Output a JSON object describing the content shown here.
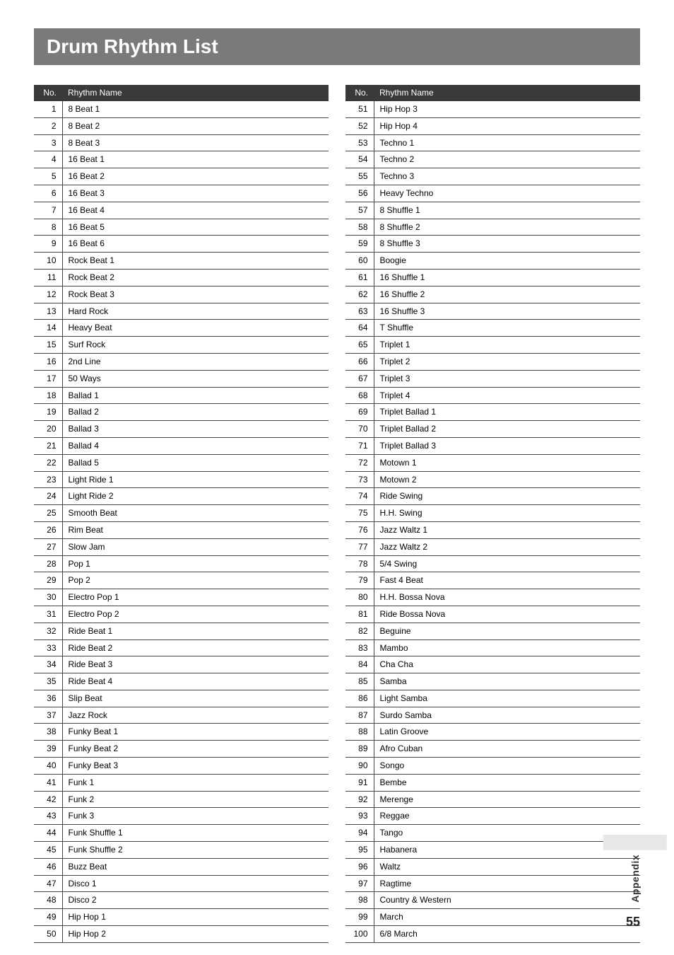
{
  "title": "Drum Rhythm List",
  "headers": {
    "no": "No.",
    "name": "Rhythm Name"
  },
  "side_label": "Appendix",
  "page_number": "55",
  "left_rows": [
    {
      "no": "1",
      "name": "8 Beat 1"
    },
    {
      "no": "2",
      "name": "8 Beat 2"
    },
    {
      "no": "3",
      "name": "8 Beat 3"
    },
    {
      "no": "4",
      "name": "16 Beat 1"
    },
    {
      "no": "5",
      "name": "16 Beat 2"
    },
    {
      "no": "6",
      "name": "16 Beat 3"
    },
    {
      "no": "7",
      "name": "16 Beat 4"
    },
    {
      "no": "8",
      "name": "16 Beat 5"
    },
    {
      "no": "9",
      "name": "16 Beat 6"
    },
    {
      "no": "10",
      "name": "Rock Beat 1"
    },
    {
      "no": "11",
      "name": "Rock Beat 2"
    },
    {
      "no": "12",
      "name": "Rock Beat 3"
    },
    {
      "no": "13",
      "name": "Hard Rock"
    },
    {
      "no": "14",
      "name": "Heavy Beat"
    },
    {
      "no": "15",
      "name": "Surf Rock"
    },
    {
      "no": "16",
      "name": "2nd Line"
    },
    {
      "no": "17",
      "name": "50 Ways"
    },
    {
      "no": "18",
      "name": "Ballad 1"
    },
    {
      "no": "19",
      "name": "Ballad 2"
    },
    {
      "no": "20",
      "name": "Ballad 3"
    },
    {
      "no": "21",
      "name": "Ballad 4"
    },
    {
      "no": "22",
      "name": "Ballad 5"
    },
    {
      "no": "23",
      "name": "Light Ride 1"
    },
    {
      "no": "24",
      "name": "Light Ride 2"
    },
    {
      "no": "25",
      "name": "Smooth Beat"
    },
    {
      "no": "26",
      "name": "Rim Beat"
    },
    {
      "no": "27",
      "name": "Slow Jam"
    },
    {
      "no": "28",
      "name": "Pop 1"
    },
    {
      "no": "29",
      "name": "Pop 2"
    },
    {
      "no": "30",
      "name": "Electro Pop 1"
    },
    {
      "no": "31",
      "name": "Electro Pop 2"
    },
    {
      "no": "32",
      "name": "Ride Beat 1"
    },
    {
      "no": "33",
      "name": "Ride Beat 2"
    },
    {
      "no": "34",
      "name": "Ride Beat 3"
    },
    {
      "no": "35",
      "name": "Ride Beat 4"
    },
    {
      "no": "36",
      "name": "Slip Beat"
    },
    {
      "no": "37",
      "name": "Jazz Rock"
    },
    {
      "no": "38",
      "name": "Funky Beat 1"
    },
    {
      "no": "39",
      "name": "Funky Beat 2"
    },
    {
      "no": "40",
      "name": "Funky Beat 3"
    },
    {
      "no": "41",
      "name": "Funk 1"
    },
    {
      "no": "42",
      "name": "Funk 2"
    },
    {
      "no": "43",
      "name": "Funk 3"
    },
    {
      "no": "44",
      "name": "Funk Shuffle 1"
    },
    {
      "no": "45",
      "name": "Funk Shuffle 2"
    },
    {
      "no": "46",
      "name": "Buzz Beat"
    },
    {
      "no": "47",
      "name": "Disco 1"
    },
    {
      "no": "48",
      "name": "Disco 2"
    },
    {
      "no": "49",
      "name": "Hip Hop 1"
    },
    {
      "no": "50",
      "name": "Hip Hop 2"
    }
  ],
  "right_rows": [
    {
      "no": "51",
      "name": "Hip Hop 3"
    },
    {
      "no": "52",
      "name": "Hip Hop 4"
    },
    {
      "no": "53",
      "name": "Techno 1"
    },
    {
      "no": "54",
      "name": "Techno 2"
    },
    {
      "no": "55",
      "name": "Techno 3"
    },
    {
      "no": "56",
      "name": "Heavy Techno"
    },
    {
      "no": "57",
      "name": "8 Shuffle 1"
    },
    {
      "no": "58",
      "name": "8 Shuffle 2"
    },
    {
      "no": "59",
      "name": "8 Shuffle 3"
    },
    {
      "no": "60",
      "name": "Boogie"
    },
    {
      "no": "61",
      "name": "16 Shuffle 1"
    },
    {
      "no": "62",
      "name": "16 Shuffle 2"
    },
    {
      "no": "63",
      "name": "16 Shuffle 3"
    },
    {
      "no": "64",
      "name": "T Shuffle"
    },
    {
      "no": "65",
      "name": "Triplet 1"
    },
    {
      "no": "66",
      "name": "Triplet 2"
    },
    {
      "no": "67",
      "name": "Triplet 3"
    },
    {
      "no": "68",
      "name": "Triplet 4"
    },
    {
      "no": "69",
      "name": "Triplet Ballad 1"
    },
    {
      "no": "70",
      "name": "Triplet Ballad 2"
    },
    {
      "no": "71",
      "name": "Triplet Ballad 3"
    },
    {
      "no": "72",
      "name": "Motown 1"
    },
    {
      "no": "73",
      "name": "Motown 2"
    },
    {
      "no": "74",
      "name": "Ride Swing"
    },
    {
      "no": "75",
      "name": "H.H. Swing"
    },
    {
      "no": "76",
      "name": "Jazz Waltz 1"
    },
    {
      "no": "77",
      "name": "Jazz Waltz 2"
    },
    {
      "no": "78",
      "name": "5/4 Swing"
    },
    {
      "no": "79",
      "name": "Fast 4 Beat"
    },
    {
      "no": "80",
      "name": "H.H. Bossa Nova"
    },
    {
      "no": "81",
      "name": "Ride Bossa Nova"
    },
    {
      "no": "82",
      "name": "Beguine"
    },
    {
      "no": "83",
      "name": "Mambo"
    },
    {
      "no": "84",
      "name": "Cha Cha"
    },
    {
      "no": "85",
      "name": "Samba"
    },
    {
      "no": "86",
      "name": "Light Samba"
    },
    {
      "no": "87",
      "name": "Surdo Samba"
    },
    {
      "no": "88",
      "name": "Latin Groove"
    },
    {
      "no": "89",
      "name": "Afro Cuban"
    },
    {
      "no": "90",
      "name": "Songo"
    },
    {
      "no": "91",
      "name": "Bembe"
    },
    {
      "no": "92",
      "name": "Merenge"
    },
    {
      "no": "93",
      "name": "Reggae"
    },
    {
      "no": "94",
      "name": "Tango"
    },
    {
      "no": "95",
      "name": "Habanera"
    },
    {
      "no": "96",
      "name": "Waltz"
    },
    {
      "no": "97",
      "name": "Ragtime"
    },
    {
      "no": "98",
      "name": "Country & Western"
    },
    {
      "no": "99",
      "name": "March"
    },
    {
      "no": "100",
      "name": "6/8 March"
    }
  ]
}
